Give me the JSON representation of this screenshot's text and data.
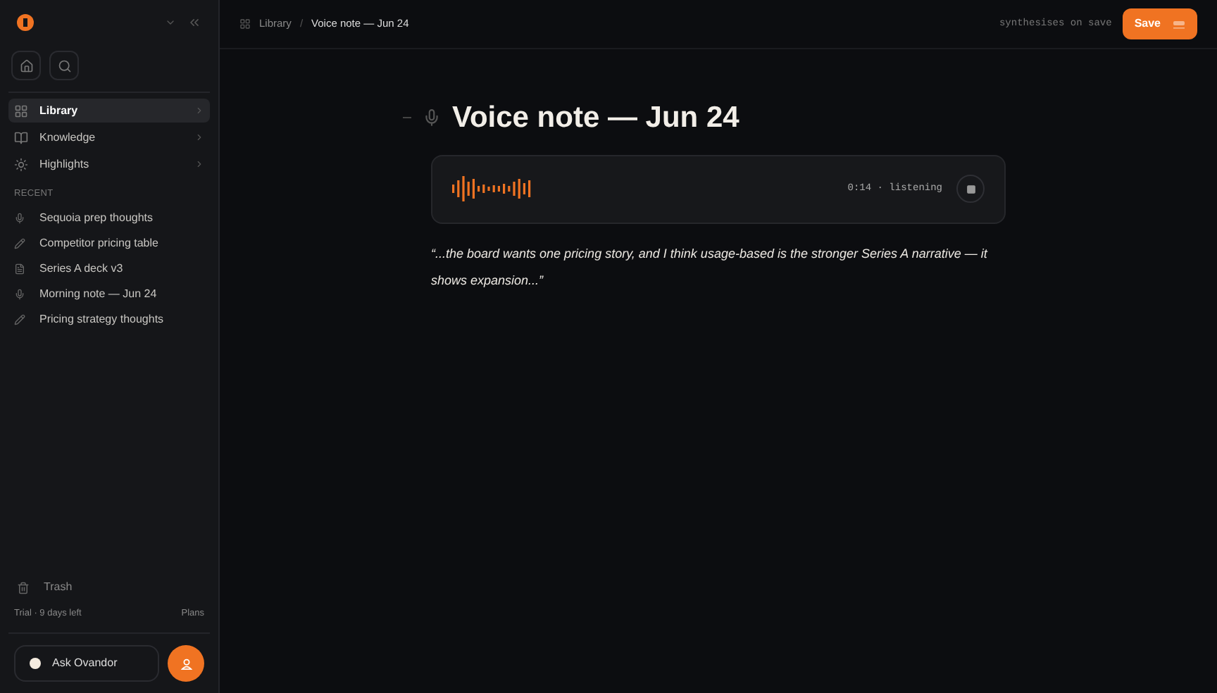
{
  "sidebar": {
    "nav": [
      {
        "label": "Library",
        "kind": "library",
        "selected": true
      },
      {
        "label": "Knowledge",
        "kind": "knowledge",
        "selected": false
      },
      {
        "label": "Highlights",
        "kind": "highlights",
        "selected": false
      }
    ],
    "recent_heading": "RECENT",
    "recent": [
      {
        "label": "Sequoia prep thoughts",
        "kind": "voice"
      },
      {
        "label": "Competitor pricing table",
        "kind": "edit"
      },
      {
        "label": "Series A deck v3",
        "kind": "doc"
      },
      {
        "label": "Morning note — Jun 24",
        "kind": "voice"
      },
      {
        "label": "Pricing strategy thoughts",
        "kind": "edit"
      }
    ],
    "trash": "Trash",
    "trial": "Trial · 9 days left",
    "plans": "Plans",
    "ask": "Ask Ovandor"
  },
  "header": {
    "breadcrumb": [
      "Library",
      "Voice note — Jun 24"
    ],
    "separator": "/",
    "hint": "synthesises on save",
    "save": "Save"
  },
  "note": {
    "title": "Voice note — Jun 24",
    "status": "0:14 · listening",
    "transcript": "“...the board wants one pricing story, and I think usage-based is the stronger Series A narrative — it shows expansion...”"
  }
}
